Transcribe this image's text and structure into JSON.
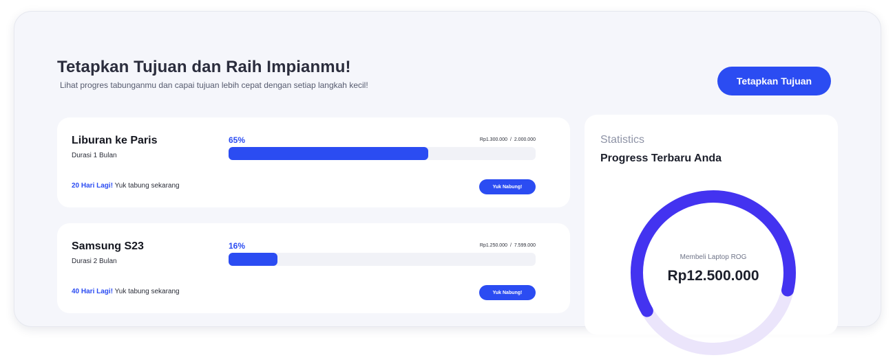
{
  "header": {
    "title": "Tetapkan Tujuan dan Raih Impianmu!",
    "subtitle": "Lihat progres tabunganmu dan capai tujuan lebih cepat dengan setiap langkah kecil!",
    "cta_label": "Tetapkan Tujuan"
  },
  "goals": [
    {
      "name": "Liburan ke Paris",
      "duration": "Durasi 1 Bulan",
      "percent_label": "65%",
      "progress": 0.65,
      "saved": "Rp1.300.000",
      "target": "2.000.000",
      "separator": "/",
      "days_left": "20 Hari Lagi!",
      "encouragement": "Yuk tabung sekarang",
      "button_label": "Yuk Nabung!"
    },
    {
      "name": "Samsung S23",
      "duration": "Durasi 2 Bulan",
      "percent_label": "16%",
      "progress": 0.16,
      "saved": "Rp1.250.000",
      "target": "7.599.000",
      "separator": "/",
      "days_left": "40 Hari Lagi!",
      "encouragement": "Yuk tabung sekarang",
      "button_label": "Yuk Nabung!"
    }
  ],
  "stats": {
    "heading": "Statistics",
    "subheading": "Progress Terbaru Anda",
    "goal_label": "Membeli Laptop ROG",
    "goal_value": "Rp12.500.000",
    "progress": 0.62
  },
  "colors": {
    "primary": "#2b4cf2",
    "ring_primary": "#4333f0",
    "ring_track": "#ebe5fb",
    "background": "#f5f6fb",
    "card": "#ffffff"
  }
}
